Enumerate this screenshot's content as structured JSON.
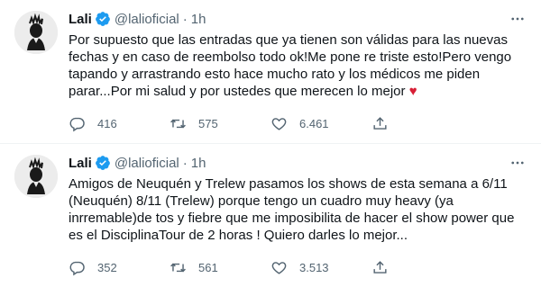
{
  "tweets": [
    {
      "name": "Lali",
      "handle": "@lalioficial",
      "separator": "·",
      "time": "1h",
      "text": "Por supuesto que las entradas que ya tienen son válidas para las nuevas fechas y en caso de reembolso todo ok!Me pone re triste esto!Pero vengo tapando y arrastrando esto hace mucho rato y los médicos me piden parar...Por mi salud y por ustedes que merecen lo mejor ",
      "emoji": "♥",
      "replies": "416",
      "retweets": "575",
      "likes": "6.461"
    },
    {
      "name": "Lali",
      "handle": "@lalioficial",
      "separator": "·",
      "time": "1h",
      "text": "Amigos de Neuquén y Trelew pasamos los shows de esta semana a 6/11 (Neuquén) 8/11 (Trelew) porque tengo un cuadro muy heavy (ya inrremable)de tos y fiebre que me imposibilita de hacer el show power que es el DisciplinaTour de 2 horas ! Quiero darles lo mejor...",
      "emoji": "",
      "replies": "352",
      "retweets": "561",
      "likes": "3.513"
    }
  ],
  "colors": {
    "verified": "#1d9bf0",
    "secondary_text": "#536471",
    "heart": "#d81f36"
  },
  "icons": [
    "avatar",
    "verified-badge-icon",
    "more-icon",
    "reply-icon",
    "retweet-icon",
    "like-icon",
    "share-icon"
  ]
}
